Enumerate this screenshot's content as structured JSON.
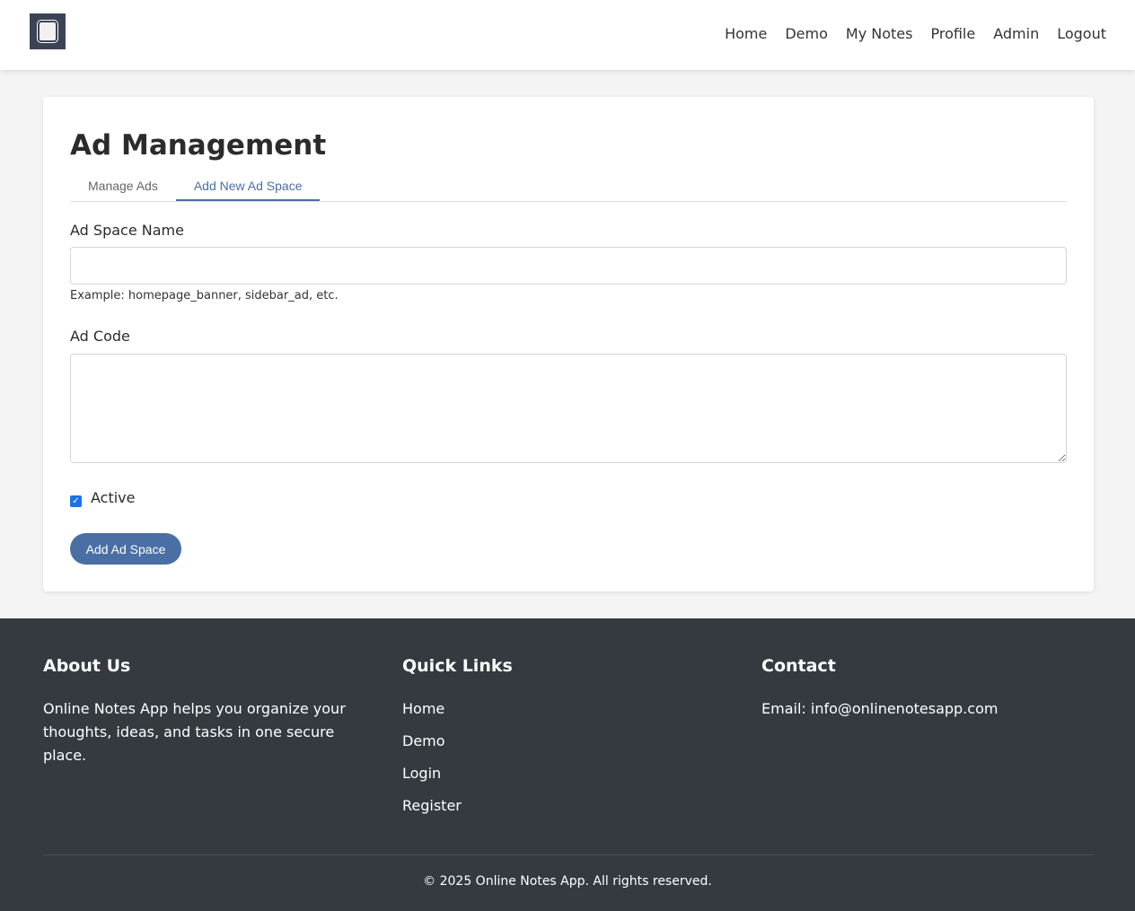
{
  "nav": [
    "Home",
    "Demo",
    "My Notes",
    "Profile",
    "Admin",
    "Logout"
  ],
  "page_title": "Ad Management",
  "tabs": [
    "Manage Ads",
    "Add New Ad Space"
  ],
  "form": {
    "name_label": "Ad Space Name",
    "name_value": "",
    "name_help": "Example: homepage_banner, sidebar_ad, etc.",
    "code_label": "Ad Code",
    "code_value": "",
    "active_label": "Active",
    "active_checked": true,
    "submit": "Add Ad Space"
  },
  "footer": {
    "about_title": "About Us",
    "about_text": "Online Notes App helps you organize your thoughts, ideas, and tasks in one secure place.",
    "links_title": "Quick Links",
    "links": [
      "Home",
      "Demo",
      "Login",
      "Register"
    ],
    "contact_title": "Contact",
    "contact_email": "Email: info@onlinenotesapp.com",
    "copyright": "© 2025 Online Notes App. All rights reserved."
  }
}
